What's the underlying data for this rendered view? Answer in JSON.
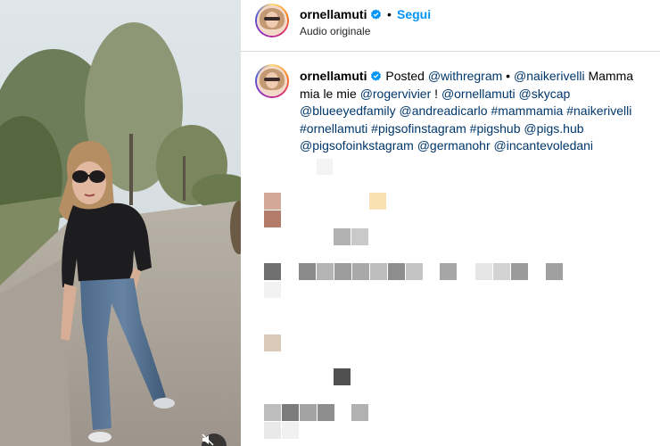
{
  "header": {
    "username": "ornellamuti",
    "verified": true,
    "separator": "•",
    "follow_label": "Segui",
    "subtitle": "Audio originale"
  },
  "caption": {
    "username": "ornellamuti",
    "posted_word": "Posted",
    "segments": [
      {
        "t": "link",
        "v": "@withregram"
      },
      {
        "t": "text",
        "v": " • "
      },
      {
        "t": "link",
        "v": "@naikerivelli"
      },
      {
        "t": "text",
        "v": " Mamma mia le mie "
      },
      {
        "t": "link",
        "v": "@rogervivier"
      },
      {
        "t": "text",
        "v": " ! "
      },
      {
        "t": "link",
        "v": "@ornellamuti"
      },
      {
        "t": "text",
        "v": " "
      },
      {
        "t": "link",
        "v": "@skycap"
      },
      {
        "t": "text",
        "v": " "
      },
      {
        "t": "link",
        "v": "@blueeyedfamily"
      },
      {
        "t": "text",
        "v": " "
      },
      {
        "t": "link",
        "v": "@andreadicarlo"
      },
      {
        "t": "text",
        "v": " "
      },
      {
        "t": "link",
        "v": "#mammamia"
      },
      {
        "t": "text",
        "v": " "
      },
      {
        "t": "link",
        "v": "#naikerivelli"
      },
      {
        "t": "text",
        "v": " "
      },
      {
        "t": "link",
        "v": "#ornellamuti"
      },
      {
        "t": "text",
        "v": " "
      },
      {
        "t": "link",
        "v": "#pigsofinstagram"
      },
      {
        "t": "text",
        "v": " "
      },
      {
        "t": "link",
        "v": "#pigshub"
      },
      {
        "t": "text",
        "v": " "
      },
      {
        "t": "link",
        "v": "@pigs.hub"
      },
      {
        "t": "text",
        "v": " "
      },
      {
        "t": "link",
        "v": "@pigsofoinkstagram"
      },
      {
        "t": "text",
        "v": " "
      },
      {
        "t": "link",
        "v": "@germanohr"
      },
      {
        "t": "text",
        "v": " "
      },
      {
        "t": "link",
        "v": "@incantevoledani"
      }
    ]
  },
  "media": {
    "mute_icon": "speaker-muted-icon"
  },
  "colors": {
    "follow": "#0095f6",
    "link": "#00376b",
    "verified": "#0095f6",
    "border": "#dbdbdb"
  }
}
